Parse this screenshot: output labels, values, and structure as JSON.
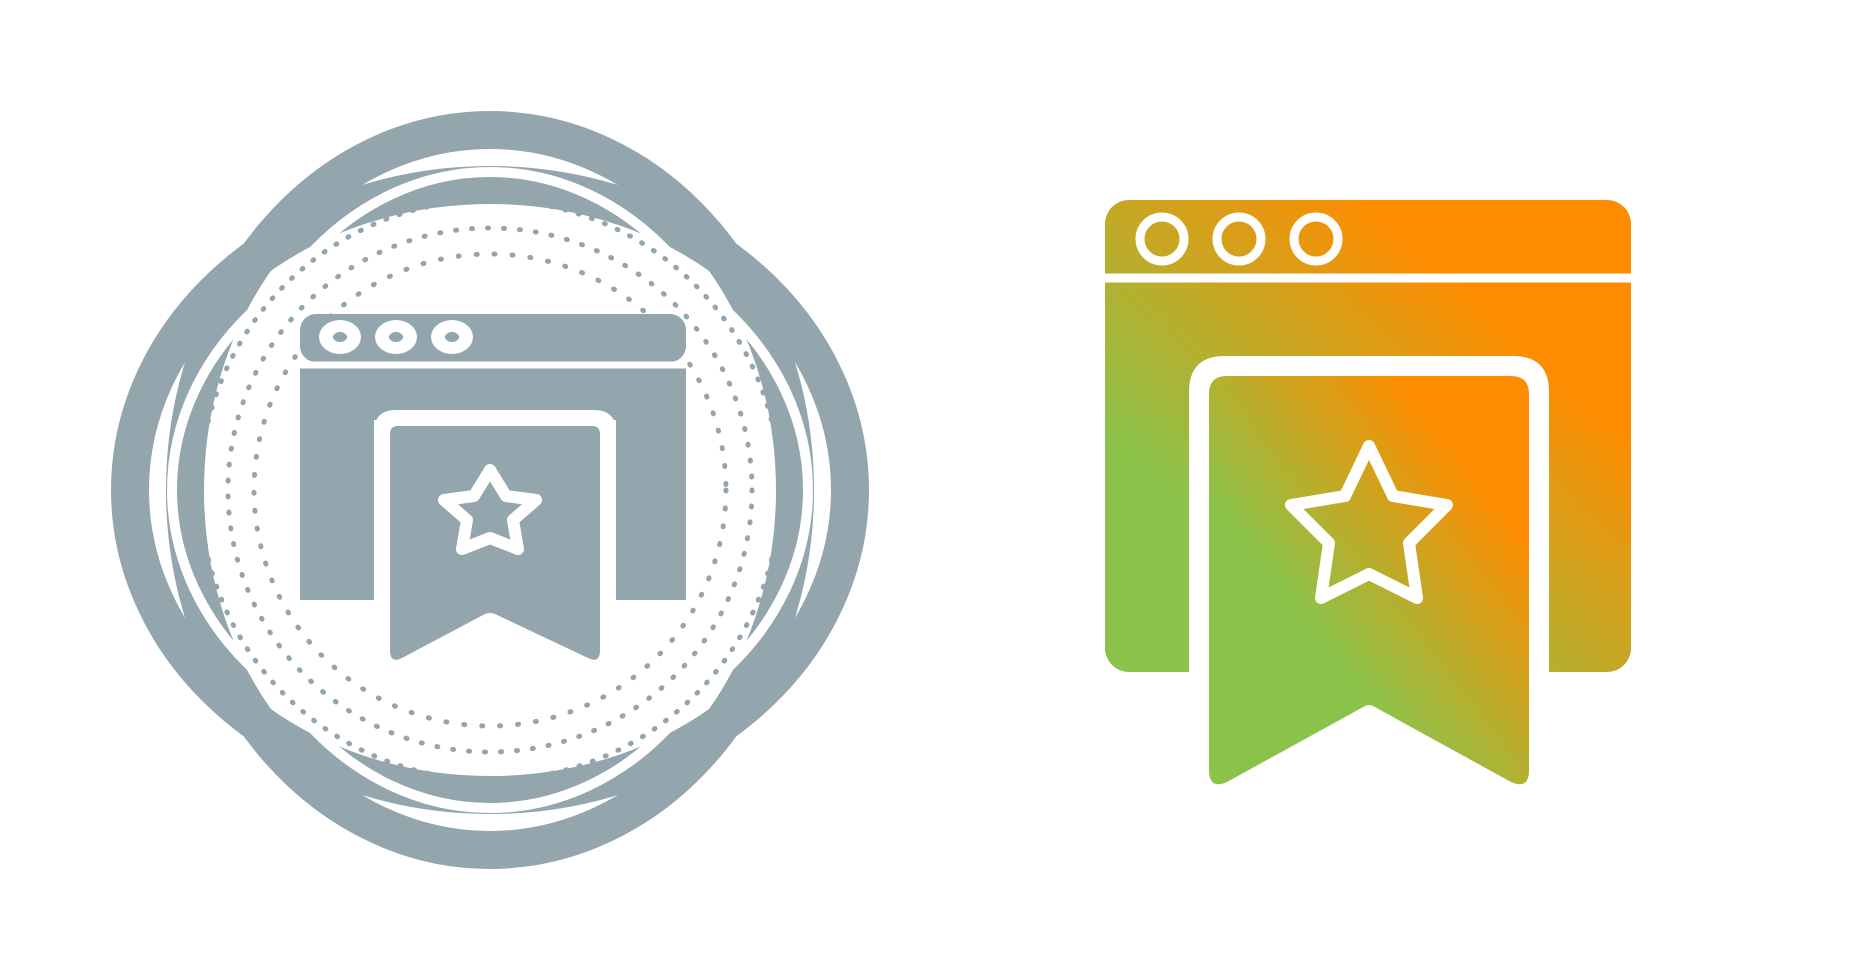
{
  "icons": [
    {
      "name": "bookmark-browser-icon",
      "style": "glyph-badge",
      "color": "#93a5ad"
    },
    {
      "name": "bookmark-browser-icon",
      "style": "gradient",
      "gradient_start": "#8bc34a",
      "gradient_end": "#ff8c00"
    }
  ],
  "colors": {
    "background": "#ffffff",
    "stroke": "#ffffff"
  }
}
